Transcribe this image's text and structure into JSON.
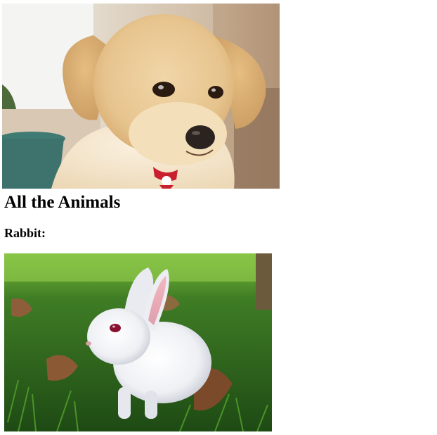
{
  "page": {
    "heading": "All the Animals",
    "subheading": "Rabbit:"
  },
  "images": {
    "puppy": {
      "icon": "puppy-photo",
      "alt": ""
    },
    "rabbit": {
      "icon": "rabbit-photo",
      "alt": ""
    }
  },
  "colors": {
    "background": "#ffffff",
    "text": "#000000"
  }
}
